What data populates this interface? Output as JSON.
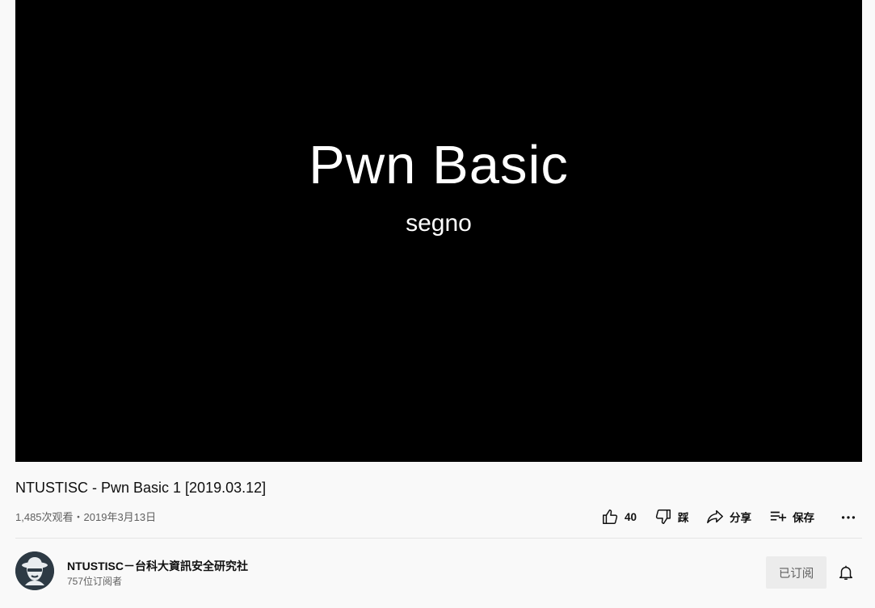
{
  "video": {
    "slide_title": "Pwn Basic",
    "slide_subtitle": "segno",
    "title": "NTUSTISC - Pwn Basic 1 [2019.03.12]",
    "meta": "1,485次观看・2019年3月13日"
  },
  "actions": {
    "like_count": "40",
    "dislike_label": "踩",
    "share_label": "分享",
    "save_label": "保存"
  },
  "channel": {
    "name": "NTUSTISC－台科大資訊安全研究社",
    "subscribers": "757位订阅者",
    "subscribed_label": "已订阅"
  },
  "icons": {
    "like": "thumbs-up-icon",
    "dislike": "thumbs-down-icon",
    "share": "share-arrow-icon",
    "save": "playlist-add-icon",
    "more": "more-horizontal-icon",
    "bell": "bell-icon"
  },
  "colors": {
    "page_bg": "#f9f9f9",
    "player_bg": "#000000",
    "subscribed_bg": "#ececec",
    "secondary_text": "#606060"
  }
}
